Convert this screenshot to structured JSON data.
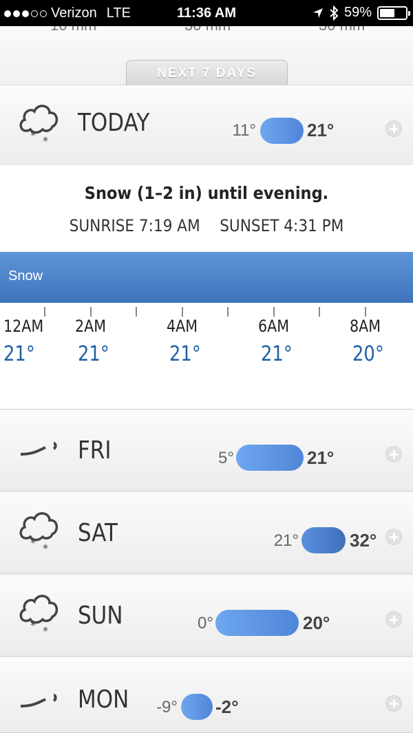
{
  "status_bar": {
    "carrier": "Verizon",
    "network": "LTE",
    "time": "11:36 AM",
    "battery": "59%",
    "battery_level": 0.59,
    "signal_bars": 3
  },
  "tab_label": "NEXT 7 DAYS",
  "days": [
    {
      "label": "TODAY",
      "icon": "snow-cloud-icon",
      "low": "11°",
      "high": "21°"
    },
    {
      "label": "FRI",
      "icon": "wind-icon",
      "low": "5°",
      "high": "21°"
    },
    {
      "label": "SAT",
      "icon": "snow-cloud-icon",
      "low": "21°",
      "high": "32°"
    },
    {
      "label": "SUN",
      "icon": "snow-cloud-icon",
      "low": "0°",
      "high": "20°"
    },
    {
      "label": "MON",
      "icon": "wind-icon",
      "low": "-9°",
      "high": "-2°"
    }
  ],
  "detail": {
    "summary": "Snow (1–2 in) until evening.",
    "sunrise": "SUNRISE 7:19 AM",
    "sunset": "SUNSET 4:31 PM",
    "condition": "Snow",
    "hours": [
      {
        "time": "12AM",
        "temp": "21°"
      },
      {
        "time": "2AM",
        "temp": "21°"
      },
      {
        "time": "4AM",
        "temp": "21°"
      },
      {
        "time": "6AM",
        "temp": "21°"
      },
      {
        "time": "8AM",
        "temp": "20°"
      }
    ]
  },
  "colors": {
    "accent": "#4f86d8",
    "hour_temp": "#1f5fa4",
    "condition_bar": "#3f74bd"
  }
}
